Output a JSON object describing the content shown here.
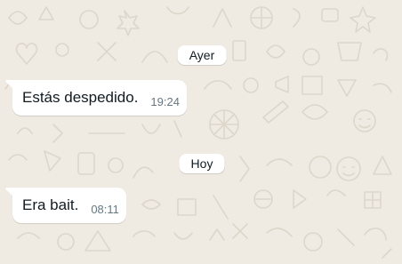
{
  "chat": {
    "background_color": "#efeae2",
    "date_separators": [
      {
        "label": "Ayer"
      },
      {
        "label": "Hoy"
      }
    ],
    "messages": [
      {
        "text": "Estás despedido.",
        "time": "19:24"
      },
      {
        "text": "Era bait.",
        "time": "08:11"
      }
    ]
  }
}
